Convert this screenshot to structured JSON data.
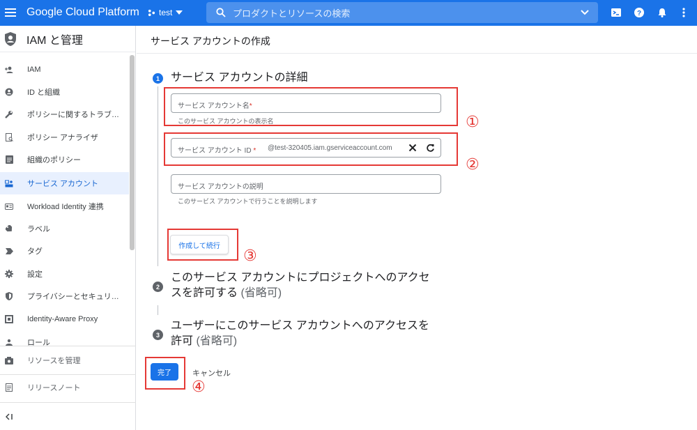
{
  "topbar": {
    "brand": "Google Cloud Platform",
    "project": "test",
    "search_placeholder": "プロダクトとリソースの検索"
  },
  "sidebar": {
    "title": "IAM と管理",
    "items": [
      {
        "label": "IAM",
        "icon": "person-add-icon"
      },
      {
        "label": "ID と組織",
        "icon": "account-circle-icon"
      },
      {
        "label": "ポリシーに関するトラブ…",
        "icon": "wrench-icon"
      },
      {
        "label": "ポリシー アナライザ",
        "icon": "document-search-icon"
      },
      {
        "label": "組織のポリシー",
        "icon": "list-doc-icon"
      },
      {
        "label": "サービス アカウント",
        "icon": "service-account-icon"
      },
      {
        "label": "Workload Identity 連携",
        "icon": "id-card-icon"
      },
      {
        "label": "ラベル",
        "icon": "label-icon"
      },
      {
        "label": "タグ",
        "icon": "tag-icon"
      },
      {
        "label": "設定",
        "icon": "gear-icon"
      },
      {
        "label": "プライバシーとセキュリ…",
        "icon": "shield-icon"
      },
      {
        "label": "Identity-Aware Proxy",
        "icon": "proxy-icon"
      },
      {
        "label": "ロール",
        "icon": "roles-icon"
      }
    ],
    "bottom": [
      {
        "label": "リソースを管理",
        "icon": "manage-resources-icon"
      },
      {
        "label": "リリースノート",
        "icon": "release-notes-icon"
      }
    ]
  },
  "page": {
    "title": "サービス アカウントの作成",
    "step1": {
      "num": "1",
      "title": "サービス アカウントの詳細",
      "name_label": "サービス アカウント名",
      "name_hint": "このサービス アカウントの表示名",
      "id_label": "サービス アカウント ID",
      "id_suffix": "@test-320405.iam.gserviceaccount.com",
      "desc_label": "サービス アカウントの説明",
      "desc_hint": "このサービス アカウントで行うことを説明します",
      "required_mark": "*",
      "create_button": "作成して続行"
    },
    "step2": {
      "num": "2",
      "title_line1": "このサービス アカウントにプロジェクトへのアクセ",
      "title_line2": "スを許可する",
      "optional": "(省略可)"
    },
    "step3": {
      "num": "3",
      "title_line1": "ユーザーにこのサービス アカウントへのアクセスを",
      "title_line2": "許可",
      "optional": "(省略可)"
    },
    "done_button": "完了",
    "cancel_button": "キャンセル"
  },
  "annotations": [
    "①",
    "②",
    "③",
    "④"
  ],
  "colors": {
    "accent": "#1a73e8",
    "annotation": "#e53935",
    "active_nav_bg": "#e8f0fe"
  }
}
